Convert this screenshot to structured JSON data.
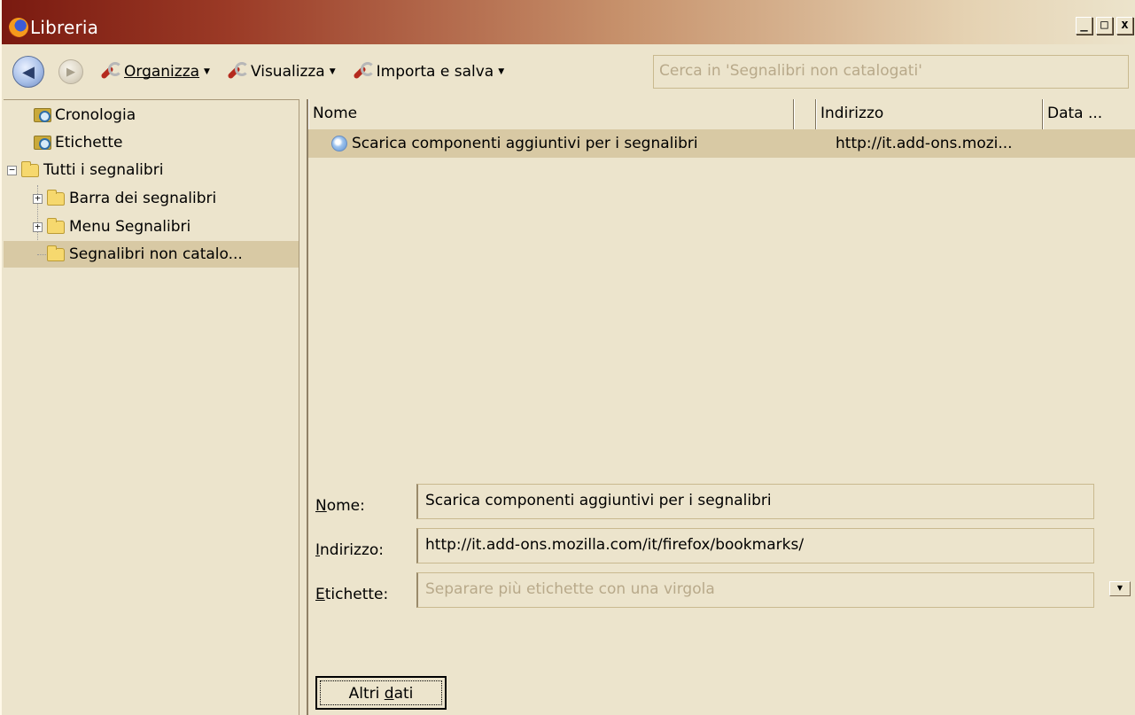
{
  "window": {
    "title": "Libreria",
    "controls": [
      "_",
      "□",
      "x"
    ]
  },
  "toolbar": {
    "back_icon": "back-arrow-icon",
    "forward_icon": "forward-arrow-icon",
    "menus": [
      {
        "label": "Organizza",
        "icon": "wrench-icon"
      },
      {
        "label": "Visualizza",
        "icon": "wrench-icon"
      },
      {
        "label": "Importa e salva",
        "icon": "wrench-icon"
      }
    ],
    "search_placeholder": "Cerca in 'Segnalibri non catalogati'"
  },
  "sidebar": {
    "items": [
      {
        "label": "Cronologia",
        "icon": "query-icon"
      },
      {
        "label": "Etichette",
        "icon": "query-icon"
      },
      {
        "label": "Tutti i segnalibri",
        "icon": "folder-open-icon",
        "expander": "−"
      },
      {
        "label": "Barra dei segnalibri",
        "icon": "folder-icon",
        "expander": "+"
      },
      {
        "label": "Menu Segnalibri",
        "icon": "folder-icon",
        "expander": "+"
      },
      {
        "label": "Segnalibri non catalo...",
        "icon": "folder-icon",
        "selected": true
      }
    ]
  },
  "list": {
    "columns": [
      "Nome",
      "",
      "Indirizzo",
      "Data ..."
    ],
    "rows": [
      {
        "name": "Scarica componenti aggiuntivi per i segnalibri",
        "address": "http://it.add-ons.mozi..."
      }
    ]
  },
  "details": {
    "name_label": "Nome:",
    "name_value": "Scarica componenti aggiuntivi per i segnalibri",
    "address_label": "Indirizzo:",
    "address_value": "http://it.add-ons.mozilla.com/it/firefox/bookmarks/",
    "tags_label": "Etichette:",
    "tags_placeholder": "Separare più etichette con una virgola",
    "more_button": "Altri dati"
  },
  "colors": {
    "background": "#ece4cc",
    "selection": "#d8c9a4",
    "title_bar_start": "#7a1a10"
  }
}
